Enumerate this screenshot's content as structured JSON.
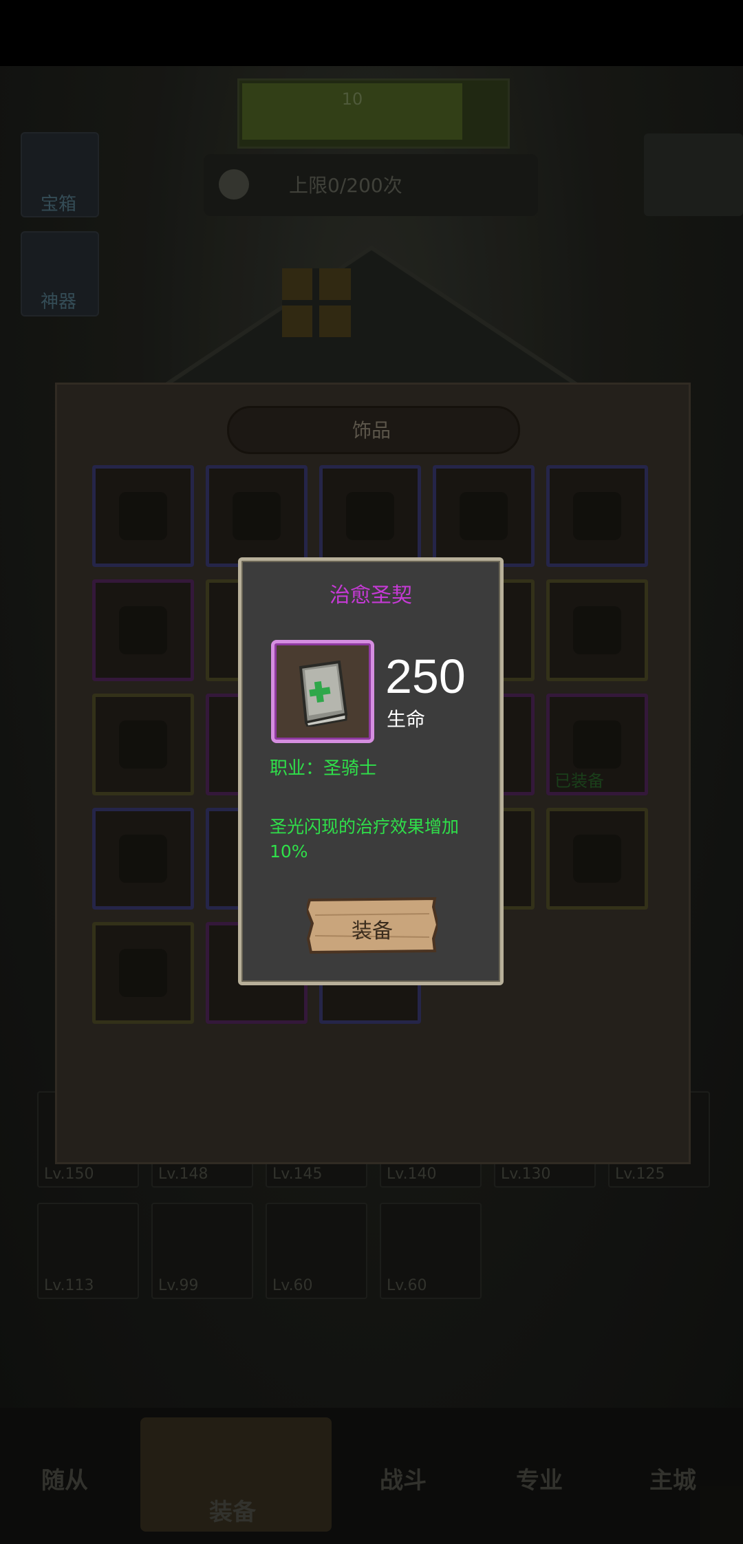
{
  "panel": {
    "title": "饰品",
    "equipped_tag": "已装备"
  },
  "background": {
    "top_progress": {
      "text": "10"
    },
    "hint": {
      "text": "上限0/200次"
    },
    "left_buttons": [
      "宝箱",
      "神器"
    ],
    "levels_row1": [
      "Lv.150",
      "Lv.148",
      "Lv.145",
      "Lv.140",
      "Lv.130",
      "Lv.125"
    ],
    "levels_row2": [
      "Lv.113",
      "Lv.99",
      "Lv.60",
      "Lv.60"
    ]
  },
  "bottom_nav": {
    "items": [
      "随从",
      "装备",
      "战斗",
      "专业",
      "主城"
    ],
    "active": "装备"
  },
  "modal": {
    "title": "治愈圣契",
    "stat_value": "250",
    "stat_name": "生命",
    "class_line": "职业：圣骑士",
    "description": "圣光闪现的治疗效果增加10%",
    "equip_button": "装备",
    "colors": {
      "title": "#c63ad6",
      "effect_text": "#2fe04a",
      "rarity_frame": "#d58ee0"
    },
    "item_icon": "holy-book-icon"
  }
}
